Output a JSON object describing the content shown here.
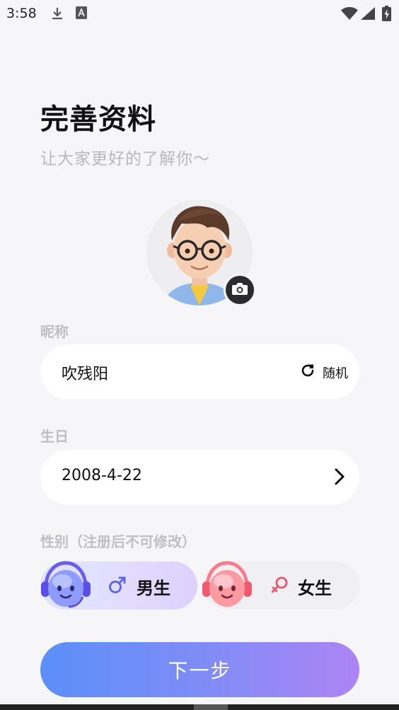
{
  "status_bar": {
    "time": "3:58"
  },
  "header": {
    "title": "完善资料",
    "subtitle": "让大家更好的了解你～"
  },
  "nickname": {
    "label": "昵称",
    "value": "吹残阳",
    "random_label": "随机"
  },
  "birthday": {
    "label": "生日",
    "value": "2008-4-22"
  },
  "gender": {
    "label": "性别（注册后不可修改）",
    "male_symbol": "♂",
    "male_label": "男生",
    "female_symbol": "♀",
    "female_label": "女生",
    "selected": "male"
  },
  "next_button": {
    "label": "下一步"
  },
  "colors": {
    "background": "#f6f6f8",
    "accent_start": "#5b8ff9",
    "accent_end": "#ad84f5",
    "male_symbol": "#5a62e8",
    "female_symbol": "#e8566f"
  }
}
